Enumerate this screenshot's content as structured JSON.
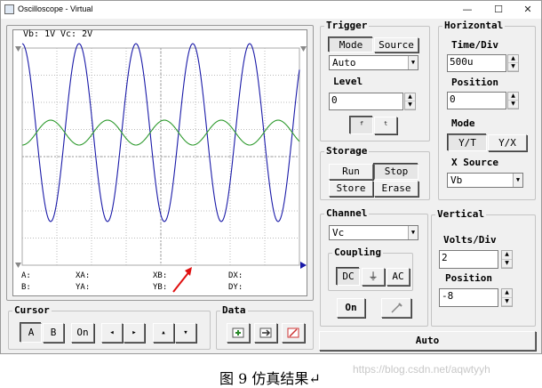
{
  "window": {
    "title": "Oscilloscope - Virtual"
  },
  "screen": {
    "vb_label": "Vb: 1V",
    "vc_label": "Vc: 2V",
    "vb_color": "#2e9a2e",
    "vc_color": "#1a1aa8",
    "readouts": {
      "a": "A:",
      "b": "B:",
      "xa": "XA:",
      "ya": "YA:",
      "xb": "XB:",
      "yb": "YB:",
      "dx": "DX:",
      "dy": "DY:"
    }
  },
  "cursor": {
    "title": "Cursor",
    "a": "A",
    "b": "B",
    "on": "On",
    "left": "◂",
    "right": "▸",
    "up": "▴",
    "down": "▾"
  },
  "data": {
    "title": "Data"
  },
  "trigger": {
    "title": "Trigger",
    "mode": "Mode",
    "source": "Source",
    "mode_value": "Auto",
    "level_label": "Level",
    "level_value": "0",
    "rise": "ᶠ",
    "fall": "ᵗ"
  },
  "storage": {
    "title": "Storage",
    "run": "Run",
    "stop": "Stop",
    "store": "Store",
    "erase": "Erase"
  },
  "horizontal": {
    "title": "Horizontal",
    "time_div_label": "Time/Div",
    "time_div": "500u",
    "position_label": "Position",
    "position": "0",
    "mode_label": "Mode",
    "yt": "Y/T",
    "yx": "Y/X",
    "x_source_label": "X Source",
    "x_source": "Vb"
  },
  "channel": {
    "title": "Channel",
    "value": "Vc",
    "coupling_title": "Coupling",
    "dc": "DC",
    "ground": "⏚",
    "ac": "AC",
    "on": "On"
  },
  "vertical": {
    "title": "Vertical",
    "volts_div_label": "Volts/Div",
    "volts_div": "2",
    "position_label": "Position",
    "position": "-8"
  },
  "auto_button": "Auto",
  "caption": "图 9  仿真结果↵",
  "watermark": "https://blog.csdn.net/aqwtyyh"
}
